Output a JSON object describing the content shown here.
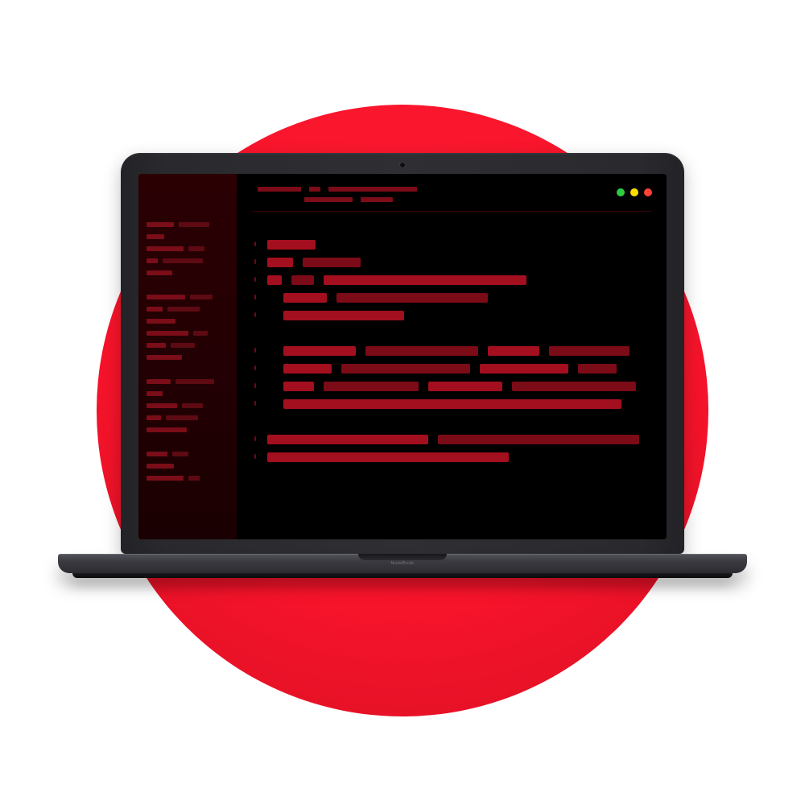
{
  "device": {
    "brand_label": "NoteBook"
  },
  "colors": {
    "code_bar": "#a30f1e",
    "code_bar_dark": "#7b0b17",
    "sidebar_bar": "#5e0a13",
    "sidebar_bar_light": "#7a0d18",
    "title_bar": "#7c0c17",
    "accent_circle": "#f8142b"
  },
  "window_controls": [
    "green",
    "yellow",
    "red"
  ],
  "title_bar": {
    "row1": [
      54,
      14,
      110
    ],
    "row2": [
      60,
      40
    ]
  },
  "sidebar_rows": [
    [
      34,
      38
    ],
    [
      22
    ],
    [
      46,
      20
    ],
    [
      14,
      50
    ],
    [
      32
    ],
    [],
    [
      48,
      28
    ],
    [
      20,
      40
    ],
    [
      36
    ],
    [
      52,
      18
    ],
    [
      24,
      30
    ],
    [
      44
    ],
    [],
    [
      30,
      48
    ],
    [
      20
    ],
    [
      38,
      26
    ],
    [
      18,
      40
    ],
    [
      50
    ],
    [],
    [
      26,
      20
    ],
    [
      34
    ],
    [
      46,
      14
    ]
  ],
  "code_lines": [
    {
      "indent": 0,
      "segs": [
        60
      ]
    },
    {
      "indent": 0,
      "segs": [
        32,
        72
      ]
    },
    {
      "indent": 0,
      "segs": [
        18,
        28,
        252
      ]
    },
    {
      "indent": 20,
      "segs": [
        54,
        188
      ]
    },
    {
      "indent": 20,
      "segs": [
        150
      ]
    },
    {
      "indent": 0,
      "segs": []
    },
    {
      "indent": 20,
      "segs": [
        90,
        140,
        64,
        100
      ]
    },
    {
      "indent": 20,
      "segs": [
        60,
        160,
        110,
        48
      ]
    },
    {
      "indent": 20,
      "segs": [
        38,
        118,
        92,
        154
      ]
    },
    {
      "indent": 20,
      "segs": [
        420
      ]
    },
    {
      "indent": 0,
      "segs": []
    },
    {
      "indent": 0,
      "segs": [
        200,
        250
      ]
    },
    {
      "indent": 0,
      "segs": [
        300
      ]
    }
  ]
}
